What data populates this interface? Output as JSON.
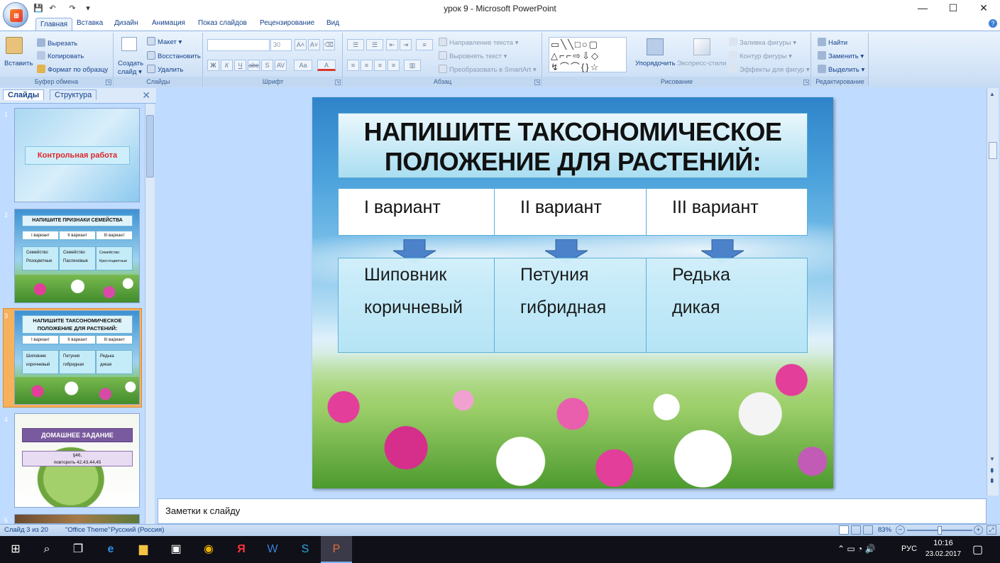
{
  "window": {
    "title": "урок 9 - Microsoft PowerPoint",
    "minimize": "—",
    "maximize": "☐",
    "close": "✕"
  },
  "qat": {
    "save_icon": "save-icon",
    "undo_icon": "undo-icon",
    "redo_icon": "redo-icon",
    "more": "▾"
  },
  "tabs": [
    "Главная",
    "Вставка",
    "Дизайн",
    "Анимация",
    "Показ слайдов",
    "Рецензирование",
    "Вид"
  ],
  "ribbon": {
    "clipboard": {
      "label": "Буфер обмена",
      "paste": "Вставить",
      "cut": "Вырезать",
      "copy": "Копировать",
      "format": "Формат по образцу"
    },
    "slides": {
      "label": "Слайды",
      "new_slide": "Создать",
      "new_slide2": "слайд ▾",
      "layout": "Макет ▾",
      "reset": "Восстановить",
      "delete": "Удалить"
    },
    "font": {
      "label": "Шрифт",
      "size": "30"
    },
    "paragraph": {
      "label": "Абзац",
      "direction": "Направление текста ▾",
      "align": "Выровнять текст ▾",
      "smartart": "Преобразовать в SmartArt ▾"
    },
    "drawing": {
      "label": "Рисование",
      "arrange": "Упорядочить",
      "styles": "Экспресс-стили",
      "fill": "Заливка фигуры ▾",
      "outline": "Контур фигуры ▾",
      "effects": "Эффекты для фигур ▾"
    },
    "editing": {
      "label": "Редактирование",
      "find": "Найти",
      "replace": "Заменить ▾",
      "select": "Выделить ▾"
    }
  },
  "panel": {
    "tab_slides": "Слайды",
    "tab_outline": "Структура",
    "close": "✕"
  },
  "thumbnails": {
    "s1": {
      "num": "1",
      "title": "Контрольная работа"
    },
    "s2": {
      "num": "2",
      "title": "НАПИШИТЕ ПРИЗНАКИ  СЕМЕЙСТВА",
      "h": [
        "I вариант",
        "II вариант",
        "III вариант"
      ],
      "b1": [
        "Семейство",
        "Семейство",
        "Семейство"
      ],
      "b2": [
        "Розоцветные",
        "Пасленовые",
        "Крестоцветные"
      ]
    },
    "s3": {
      "num": "3",
      "title1": "НАПИШИТЕ ТАКСОНОМИЧЕСКОЕ",
      "title2": "ПОЛОЖЕНИЕ ДЛЯ РАСТЕНИЙ:",
      "h": [
        "I вариант",
        "II вариант",
        "III вариант"
      ],
      "b1": [
        "Шиповник",
        "Петуния",
        "Редька"
      ],
      "b2": [
        "коричневый",
        "гибридная",
        "дикая"
      ]
    },
    "s4": {
      "num": "4",
      "title": "ДОМАШНЕЕ ЗАДАНИЕ",
      "line1": "§46,",
      "line2": "повторить 42,43,44,45"
    },
    "s5": {
      "num": "5"
    }
  },
  "slide": {
    "title_line1": "НАПИШИТЕ ТАКСОНОМИЧЕСКОЕ",
    "title_line2": "ПОЛОЖЕНИЕ ДЛЯ РАСТЕНИЙ:",
    "headers": [
      "I вариант",
      "II вариант",
      "III вариант"
    ],
    "cells": [
      {
        "line1": "Шиповник",
        "line2": "коричневый"
      },
      {
        "line1": "Петуния",
        "line2": "гибридная"
      },
      {
        "line1": "Редька",
        "line2": "дикая"
      }
    ]
  },
  "notes": {
    "placeholder": "Заметки к слайду"
  },
  "status": {
    "slide": "Слайд 3 из 20",
    "theme": "\"Office Theme\"",
    "lang": "Русский (Россия)",
    "zoom": "83%",
    "zoom_level": 0.5
  },
  "taskbar": {
    "lang": "РУС",
    "time": "10:16",
    "date": "23.02.2017"
  },
  "colors": {
    "accent": "#2b579a",
    "ribbon": "#d6e6f8",
    "slide_header": "#ffffff"
  }
}
